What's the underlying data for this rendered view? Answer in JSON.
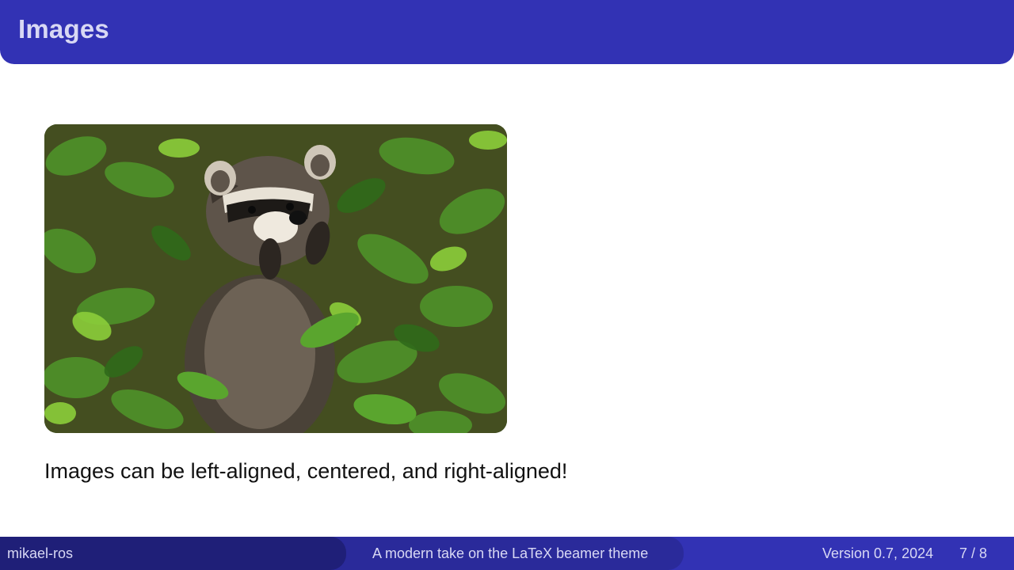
{
  "header": {
    "title": "Images"
  },
  "content": {
    "image_subject": "raccoon",
    "caption": "Images can be left-aligned, centered, and right-aligned!"
  },
  "footer": {
    "author": "mikael-ros",
    "subtitle": "A modern take on the LaTeX beamer theme",
    "version": "Version 0.7, 2024",
    "page": "7 / 8"
  },
  "colors": {
    "primary": "#3232b4",
    "footer_left": "#1f1f78",
    "footer_mid": "#2a2a9a",
    "title_text": "#d8d8f4"
  }
}
